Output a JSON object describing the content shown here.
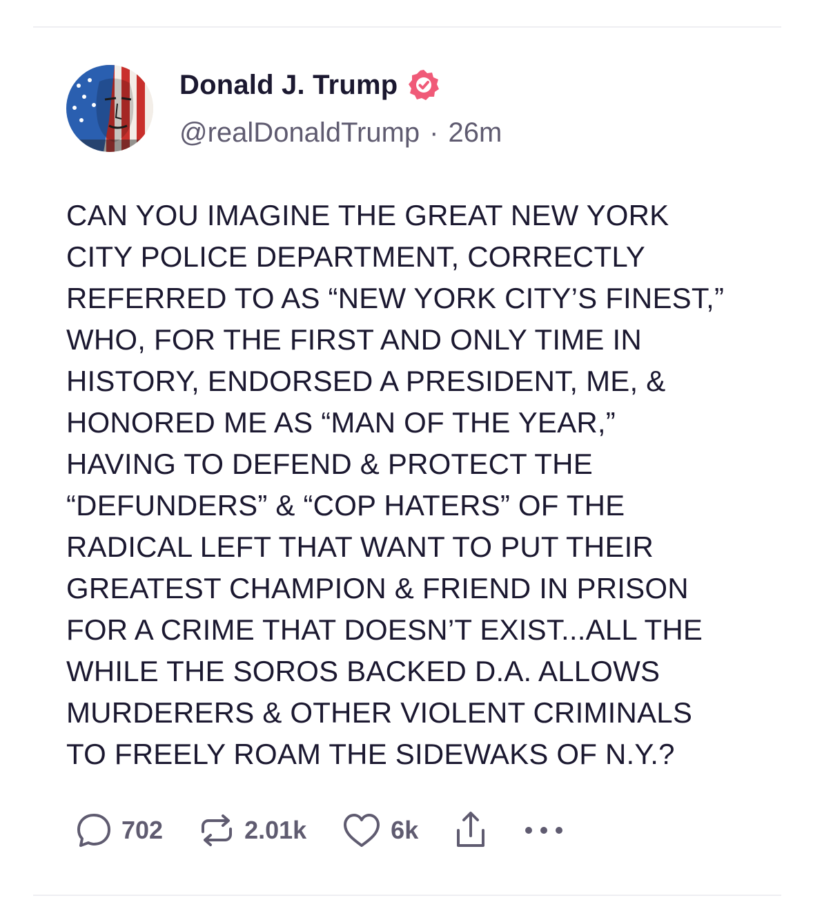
{
  "author": {
    "display_name": "Donald J. Trump",
    "handle": "@realDonaldTrump",
    "separator": "·",
    "timestamp": "26m",
    "verified_icon": "verified-badge-icon",
    "verified_color": "#f05a78"
  },
  "post": {
    "text": "CAN YOU IMAGINE THE GREAT NEW YORK\nCITY POLICE DEPARTMENT, CORRECTLY\nREFERRED TO AS “NEW YORK CITY’S FINEST,”\nWHO, FOR THE FIRST AND ONLY TIME IN\nHISTORY, ENDORSED A PRESIDENT, ME, &\nHONORED ME AS “MAN OF THE YEAR,”\nHAVING TO DEFEND & PROTECT THE\n“DEFUNDERS” & “COP HATERS” OF THE\nRADICAL LEFT THAT WANT TO PUT THEIR\nGREATEST CHAMPION & FRIEND IN PRISON\nFOR A CRIME THAT DOESN’T EXIST...ALL THE\nWHILE THE SOROS BACKED D.A. ALLOWS\nMURDERERS & OTHER VIOLENT CRIMINALS\nTO FREELY ROAM THE SIDEWAKS OF N.Y.?"
  },
  "actions": {
    "replies": {
      "icon": "reply-bubble-icon",
      "count": "702"
    },
    "retruths": {
      "icon": "retruth-icon",
      "count": "2.01k"
    },
    "likes": {
      "icon": "heart-icon",
      "count": "6k"
    },
    "share": {
      "icon": "share-icon"
    },
    "more": {
      "icon": "more-ellipsis-icon"
    }
  },
  "colors": {
    "text_primary": "#1b1830",
    "text_secondary": "#5f5b70",
    "divider": "#eeeef2",
    "icon": "#5f5b70"
  }
}
